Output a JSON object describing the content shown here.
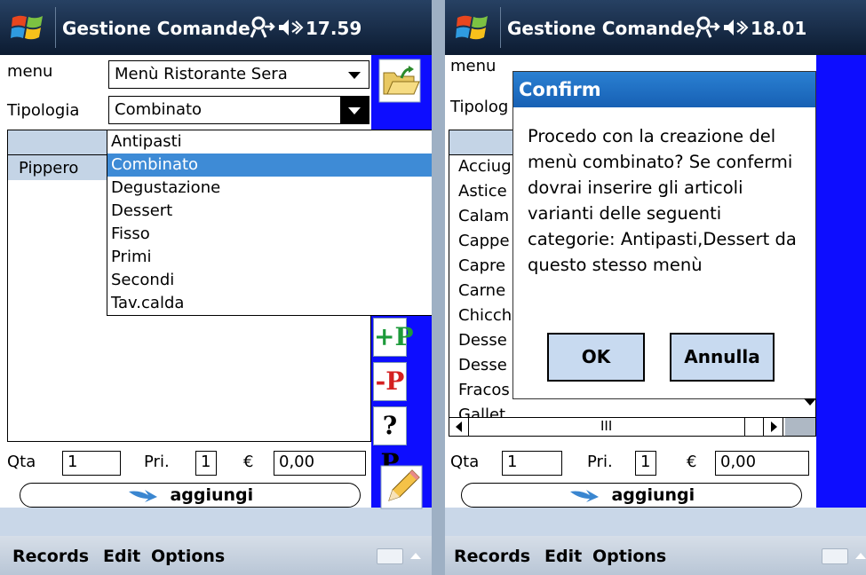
{
  "title_bar": {
    "app_title": "Gestione Comande"
  },
  "left_screen": {
    "clock": "17.59",
    "menu_label": "menu",
    "menu_value": "Menù Ristorante Sera",
    "tipologia_label": "Tipologia",
    "tipologia_value": "Combinato",
    "tipologia_options": [
      "Antipasti",
      "Combinato",
      "Degustazione",
      "Dessert",
      "Fisso",
      "Primi",
      "Secondi",
      "Tav.calda"
    ],
    "selected_option": "Combinato",
    "list_items": [
      "Pippero"
    ],
    "add_p_label": "+P",
    "remove_p_label": "-P",
    "query_p_label": "?P"
  },
  "right_screen": {
    "clock": "18.01",
    "menu_label": "menu",
    "tipologia_label": "Tipolog",
    "list_items_partial": [
      "Acciug",
      "Astice",
      "Calam",
      "Cappe",
      "Capre",
      "Carne",
      "Chicch",
      "Desse",
      "Desse",
      "Fracos",
      "Gallet"
    ],
    "dialog": {
      "title": "Confirm",
      "message": "Procedo con la creazione del menù combinato? Se confermi dovrai inserire gli articoli varianti delle seguenti categorie: Antipasti,Dessert da questo stesso menù",
      "ok_label": "OK",
      "cancel_label": "Annulla"
    },
    "scroll_thumb": "III"
  },
  "bottom_form": {
    "qta_label": "Qta",
    "qta_value": "1",
    "pri_label": "Pri.",
    "pri_value": "1",
    "currency": "€",
    "price_value": "0,00",
    "add_button": "aggiungi"
  },
  "menubar": {
    "records": "Records",
    "edit": "Edit",
    "options": "Options"
  },
  "colors": {
    "title_bg": "#0c1b31",
    "side_strip": "#0d0dff",
    "selection": "#3e8bd6",
    "dialog_title": "#1760b4"
  }
}
